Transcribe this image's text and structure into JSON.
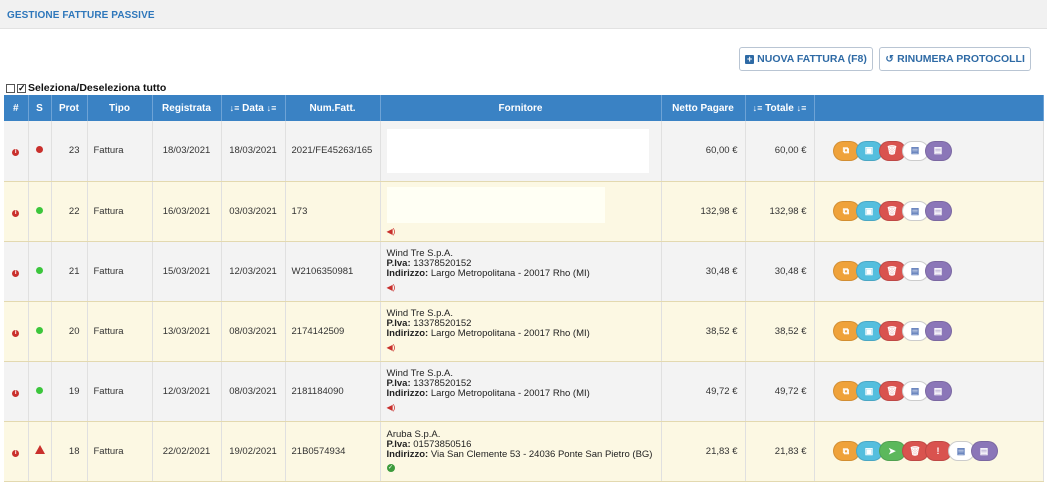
{
  "header": {
    "title": "GESTIONE FATTURE PASSIVE"
  },
  "toolbar": {
    "new_invoice_label": "NUOVA FATTURA (F8)",
    "renumber_label": "RINUMERA PROTOCOLLI"
  },
  "select_all_label": "Seleziona/Deseleziona tutto",
  "table": {
    "columns": [
      "#",
      "S",
      "Prot",
      "Tipo",
      "Registrata",
      "Data",
      "Num.Fatt.",
      "Fornitore",
      "Netto Pagare",
      "Totale",
      ""
    ],
    "rows": [
      {
        "status": "red",
        "prot": "23",
        "tipo": "Fattura",
        "registrata": "18/03/2021",
        "data": "18/03/2021",
        "num": "2021/FE45263/165",
        "supplier": null,
        "netto": "60,00 €",
        "totale": "60,00 €",
        "audio": false,
        "ok": false
      },
      {
        "status": "green",
        "prot": "22",
        "tipo": "Fattura",
        "registrata": "16/03/2021",
        "data": "03/03/2021",
        "num": "173",
        "supplier": null,
        "netto": "132,98 €",
        "totale": "132,98 €",
        "audio": true,
        "ok": false
      },
      {
        "status": "green",
        "prot": "21",
        "tipo": "Fattura",
        "registrata": "15/03/2021",
        "data": "12/03/2021",
        "num": "W2106350981",
        "supplier": {
          "name": "Wind Tre S.p.A.",
          "piva_label": "P.Iva:",
          "piva": "13378520152",
          "addr_label": "Indirizzo:",
          "addr": "Largo Metropolitana - 20017 Rho (MI)"
        },
        "netto": "30,48 €",
        "totale": "30,48 €",
        "audio": true,
        "ok": false
      },
      {
        "status": "green",
        "prot": "20",
        "tipo": "Fattura",
        "registrata": "13/03/2021",
        "data": "08/03/2021",
        "num": "2174142509",
        "supplier": {
          "name": "Wind Tre S.p.A.",
          "piva_label": "P.Iva:",
          "piva": "13378520152",
          "addr_label": "Indirizzo:",
          "addr": "Largo Metropolitana - 20017 Rho (MI)"
        },
        "netto": "38,52 €",
        "totale": "38,52 €",
        "audio": true,
        "ok": false
      },
      {
        "status": "green",
        "prot": "19",
        "tipo": "Fattura",
        "registrata": "12/03/2021",
        "data": "08/03/2021",
        "num": "2181184090",
        "supplier": {
          "name": "Wind Tre S.p.A.",
          "piva_label": "P.Iva:",
          "piva": "13378520152",
          "addr_label": "Indirizzo:",
          "addr": "Largo Metropolitana - 20017 Rho (MI)"
        },
        "netto": "49,72 €",
        "totale": "49,72 €",
        "audio": true,
        "ok": false
      },
      {
        "status": "warning",
        "prot": "18",
        "tipo": "Fattura",
        "registrata": "22/02/2021",
        "data": "19/02/2021",
        "num": "21B0574934",
        "supplier": {
          "name": "Aruba S.p.A.",
          "piva_label": "P.Iva:",
          "piva": "01573850516",
          "addr_label": "Indirizzo:",
          "addr": "Via San Clemente 53 - 24036 Ponte San Pietro (BG)"
        },
        "netto": "21,83 €",
        "totale": "21,83 €",
        "audio": false,
        "ok": true
      }
    ]
  },
  "colors": {
    "header_blue": "#3a82c4",
    "row_alt": "#fcf8e3",
    "status_red": "#c9302c",
    "status_green": "#3cc63c"
  }
}
